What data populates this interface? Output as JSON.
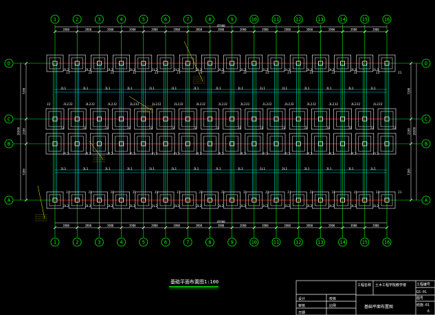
{
  "drawing": {
    "bg_color": "#000000",
    "colors": {
      "axis": "#00ff00",
      "dim": "#ffffff",
      "beam": "#ff0000",
      "column": "#ffffff",
      "footing_outer": "#ffffff",
      "footing_inner": "#ffffff",
      "tie_beam": "#00ffff",
      "label": "#ffffff",
      "callout": "#ffff00",
      "title_underline": "#00ff00",
      "table_line": "#ffffff"
    },
    "column_axis_labels": [
      "1",
      "2",
      "3",
      "4",
      "5",
      "6",
      "7",
      "8",
      "9",
      "10",
      "11",
      "12",
      "13",
      "14",
      "15",
      "16"
    ],
    "row_axis_labels": [
      "D",
      "C",
      "B",
      "A"
    ],
    "top_bay_dims": [
      "3900",
      "3900",
      "3900",
      "3900",
      "3900",
      "3900",
      "3900",
      "3900",
      "3900",
      "3900",
      "3900",
      "3900",
      "3900",
      "3900",
      "3900"
    ],
    "bottom_bay_dims": [
      "3900",
      "3900",
      "3900",
      "3900",
      "3900",
      "3900",
      "3900",
      "3900",
      "3900",
      "3900",
      "3900",
      "3900",
      "3900",
      "3900",
      "3900"
    ],
    "overall_dim": "45900",
    "left_dims": [
      "7200",
      "2100",
      "7200"
    ],
    "left_total": "16500",
    "right_dims": [
      "7200",
      "2100",
      "7200"
    ],
    "right_total": "16500",
    "footing_labels": {
      "edge": "J1",
      "middle": "J2",
      "beam_upper": "JL1",
      "beam_middle": "JL2"
    },
    "plan_title": "基础平面布置图",
    "plan_scale": "1:100"
  },
  "title_block": {
    "project_label": "工程名称",
    "project_value": "土木工程学院教学楼",
    "drawing_no_label": "工程编号",
    "drawing_no_value": "GS-01",
    "row1_left": "设计",
    "row1_right": "校核",
    "row2_left": "审核",
    "row2_right": "比例",
    "drawing_name": "基础平面布置图",
    "sheet_label": "图号",
    "sheet_value": "结施-01",
    "date_label": "日期",
    "page_value": "6"
  }
}
